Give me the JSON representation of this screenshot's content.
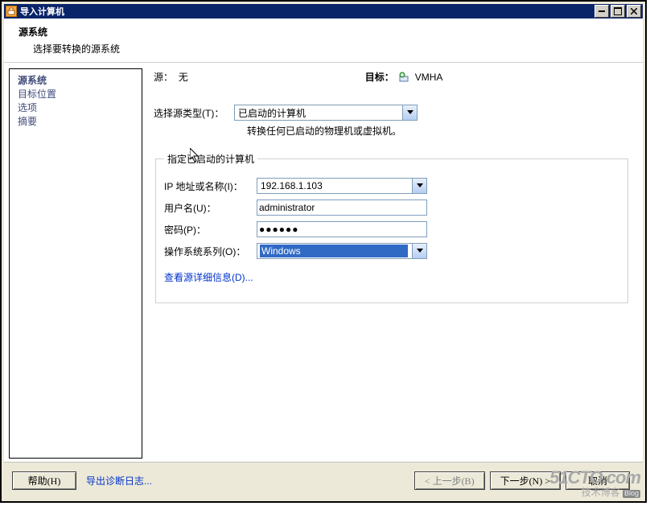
{
  "window": {
    "title": "导入计算机"
  },
  "header": {
    "title": "源系统",
    "subtitle": "选择要转换的源系统"
  },
  "sidebar": {
    "items": [
      {
        "label": "源系统",
        "active": true
      },
      {
        "label": "目标位置"
      },
      {
        "label": "选项"
      },
      {
        "label": "摘要"
      }
    ]
  },
  "top": {
    "source_label": "源：",
    "source_value": "无",
    "target_label": "目标：",
    "target_value": "VMHA"
  },
  "source_type": {
    "label": "选择源类型(T)：",
    "value": "已启动的计算机",
    "hint": "转换任何已启动的物理机或虚拟机。"
  },
  "fieldset": {
    "legend": "指定已启动的计算机",
    "ip_label": "IP 地址或名称(I)：",
    "ip_value": "192.168.1.103",
    "user_label": "用户名(U)：",
    "user_value": "administrator",
    "pw_label": "密码(P)：",
    "pw_value": "●●●●●●",
    "os_label": "操作系统系列(O)：",
    "os_value": "Windows"
  },
  "details_link": "查看源详细信息(D)...",
  "footer": {
    "help": "帮助(H)",
    "export_log": "导出诊断日志...",
    "back": "< 上一步(B)",
    "next": "下一步(N) >",
    "cancel": "取消"
  },
  "watermark": {
    "big": "51CTO.com",
    "small": "技术博客",
    "blog": "Blog"
  }
}
